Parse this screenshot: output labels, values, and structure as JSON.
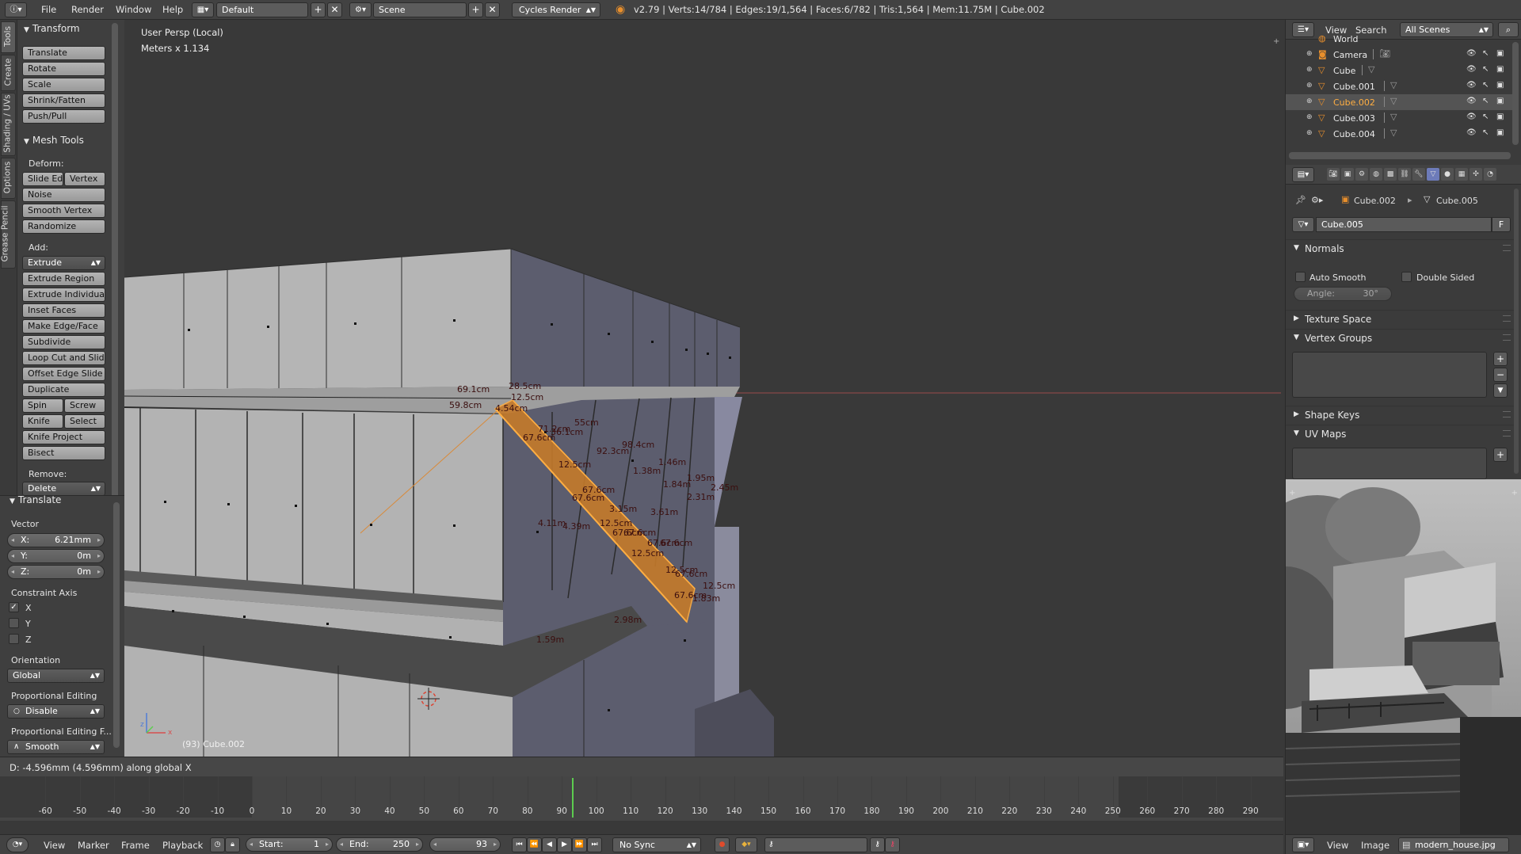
{
  "topbar": {
    "menus": [
      "File",
      "Render",
      "Window",
      "Help"
    ],
    "screen_layout": "Default",
    "scene": "Scene",
    "render_engine": "Cycles Render",
    "stats": "v2.79 | Verts:14/784 | Edges:19/1,564 | Faces:6/782 | Tris:1,564 | Mem:11.75M | Cube.002"
  },
  "shelf_tabs": [
    "Tools",
    "Create",
    "Shading / UVs",
    "Options",
    "Grease Pencil"
  ],
  "transform_panel": {
    "title": "Transform",
    "buttons": [
      "Translate",
      "Rotate",
      "Scale",
      "Shrink/Fatten",
      "Push/Pull"
    ]
  },
  "mesh_tools": {
    "title": "Mesh Tools",
    "deform_label": "Deform:",
    "slide_edge": "Slide Ed",
    "vertex": "Vertex",
    "noise": "Noise",
    "smooth_vertex": "Smooth Vertex",
    "randomize": "Randomize",
    "add_label": "Add:",
    "extrude": "Extrude",
    "add_buttons": [
      "Extrude Region",
      "Extrude Individual",
      "Inset Faces",
      "Make Edge/Face",
      "Subdivide",
      "Loop Cut and Slide",
      "Offset Edge Slide",
      "Duplicate"
    ],
    "spin": "Spin",
    "screw": "Screw",
    "knife": "Knife",
    "select": "Select",
    "knife_project": "Knife Project",
    "bisect": "Bisect",
    "remove_label": "Remove:",
    "delete": "Delete"
  },
  "operator_panel": {
    "title": "Translate",
    "vector_label": "Vector",
    "x_label": "X:",
    "x_value": "6.21mm",
    "y_label": "Y:",
    "y_value": "0m",
    "z_label": "Z:",
    "z_value": "0m",
    "constraint_label": "Constraint Axis",
    "axes": [
      {
        "label": "X",
        "checked": true
      },
      {
        "label": "Y",
        "checked": false
      },
      {
        "label": "Z",
        "checked": false
      }
    ],
    "orientation_label": "Orientation",
    "orientation_value": "Global",
    "prop_edit_label": "Proportional Editing",
    "prop_edit_value": "Disable",
    "prop_falloff_label": "Proportional Editing F...",
    "prop_falloff_value": "Smooth"
  },
  "viewport": {
    "view_name": "User Persp (Local)",
    "scale": "Meters x 1.134",
    "object_info": "(93) Cube.002",
    "measurements": [
      "69.1cm",
      "28.5cm",
      "12.5cm",
      "59.8cm",
      "4.54cm",
      "55cm",
      "71.2cm",
      "36.1cm",
      "67.6cm",
      "98.4cm",
      "92.3cm",
      "12.5cm",
      "1.46m",
      "1.38m",
      "1.95m",
      "1.84m",
      "2.45m",
      "67.6cm",
      "67.6cm",
      "2.31m",
      "3.15m",
      "3.61m",
      "12.5cm",
      "4.11m",
      "4.39m",
      "67.6cm",
      "67.6cm",
      "12.5cm",
      "67.6cm",
      "67.6cm",
      "12.5cm",
      "67.6cm",
      "67.6cm",
      "12.5cm",
      "1.83m",
      "2.98m",
      "1.59m"
    ]
  },
  "status": {
    "text": "D: -4.596mm (4.596mm) along global X"
  },
  "timeline": {
    "ticks": [
      "-60",
      "-50",
      "-40",
      "-30",
      "-20",
      "-10",
      "0",
      "10",
      "20",
      "30",
      "40",
      "50",
      "60",
      "70",
      "80",
      "90",
      "100",
      "110",
      "120",
      "130",
      "140",
      "150",
      "160",
      "170",
      "180",
      "190",
      "200",
      "210",
      "220",
      "230",
      "240",
      "250",
      "260",
      "270",
      "280",
      "290"
    ],
    "current_frame": 93,
    "menus": [
      "View",
      "Marker",
      "Frame",
      "Playback"
    ],
    "start_label": "Start:",
    "start_value": "1",
    "end_label": "End:",
    "end_value": "250",
    "current_value": "93",
    "sync": "No Sync"
  },
  "outliner": {
    "menus": [
      "View",
      "Search"
    ],
    "scene_filter": "All Scenes",
    "rows": [
      {
        "name": "World",
        "icon": "world-icon",
        "selected": false
      },
      {
        "name": "Camera",
        "icon": "camera-icon",
        "selected": false
      },
      {
        "name": "Cube",
        "icon": "mesh-icon",
        "selected": false
      },
      {
        "name": "Cube.001",
        "icon": "mesh-icon",
        "selected": false
      },
      {
        "name": "Cube.002",
        "icon": "mesh-icon",
        "selected": true
      },
      {
        "name": "Cube.003",
        "icon": "mesh-icon",
        "selected": false
      },
      {
        "name": "Cube.004",
        "icon": "mesh-icon",
        "selected": false
      }
    ]
  },
  "properties": {
    "breadcrumb_object": "Cube.002",
    "breadcrumb_mesh": "Cube.005",
    "mesh_name": "Cube.005",
    "fake_user": "F",
    "normals": "Normals",
    "auto_smooth": "Auto Smooth",
    "double_sided": "Double Sided",
    "angle_label": "Angle:",
    "angle_value": "30°",
    "texture_space": "Texture Space",
    "vertex_groups": "Vertex Groups",
    "shape_keys": "Shape Keys",
    "uv_maps": "UV Maps"
  },
  "image_editor": {
    "menus": [
      "View",
      "Image"
    ],
    "image_name": "modern_house.jpg"
  },
  "colors": {
    "accent_orange": "#ffae42",
    "selection_orange": "#e88f2c",
    "frame_green": "#5ccc4f",
    "mesh_face": "#b5b5b5",
    "mesh_side": "#5c5d6e"
  }
}
